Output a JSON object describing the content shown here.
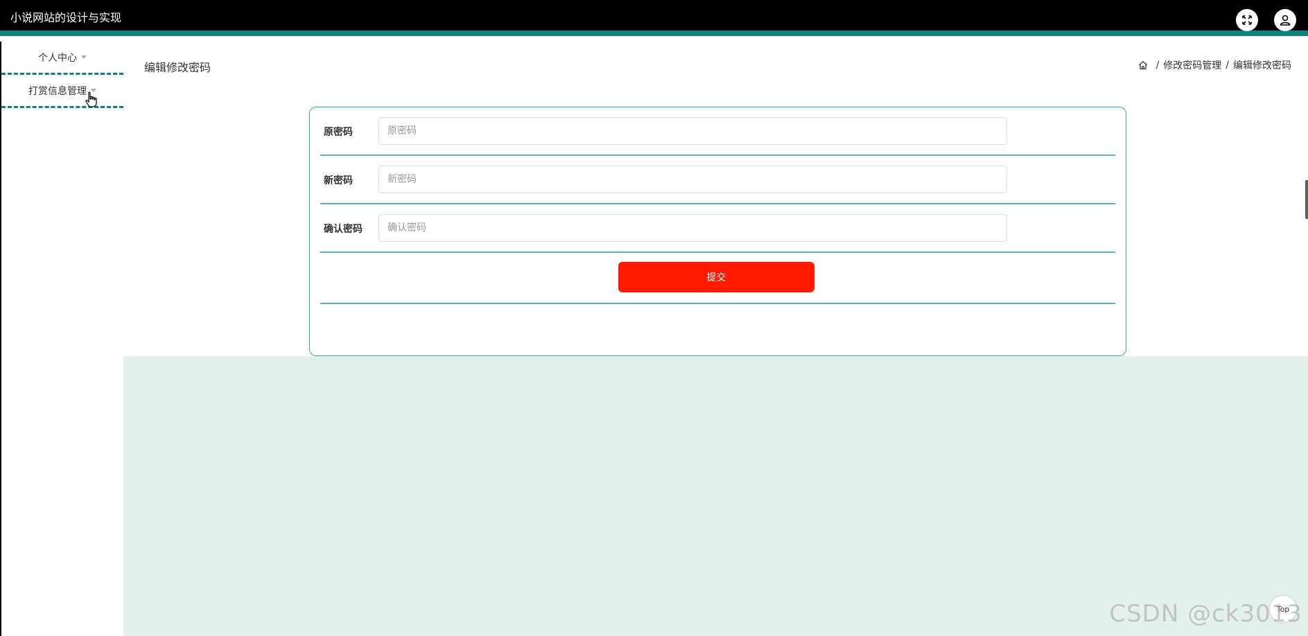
{
  "header": {
    "app_title": "小说网站的设计与实现",
    "fullscreen_icon": "fullscreen-icon",
    "user_icon": "user-icon"
  },
  "sidebar": {
    "items": [
      {
        "label": "个人中心"
      },
      {
        "label": "打赏信息管理"
      }
    ]
  },
  "page": {
    "title": "编辑修改密码"
  },
  "breadcrumb": {
    "home_icon": "home-icon",
    "items": [
      "修改密码管理",
      "编辑修改密码"
    ],
    "separator": "/"
  },
  "form": {
    "old_password": {
      "label": "原密码",
      "placeholder": "原密码"
    },
    "new_password": {
      "label": "新密码",
      "placeholder": "新密码"
    },
    "confirm_password": {
      "label": "确认密码",
      "placeholder": "确认密码"
    },
    "submit_label": "提交"
  },
  "back_to_top": "Top",
  "watermark": "CSDN @ck3013",
  "colors": {
    "accent": "#0f7f80",
    "submit": "#ff1a00",
    "main_background": "#e3f0eb",
    "topbar": "#000000"
  }
}
